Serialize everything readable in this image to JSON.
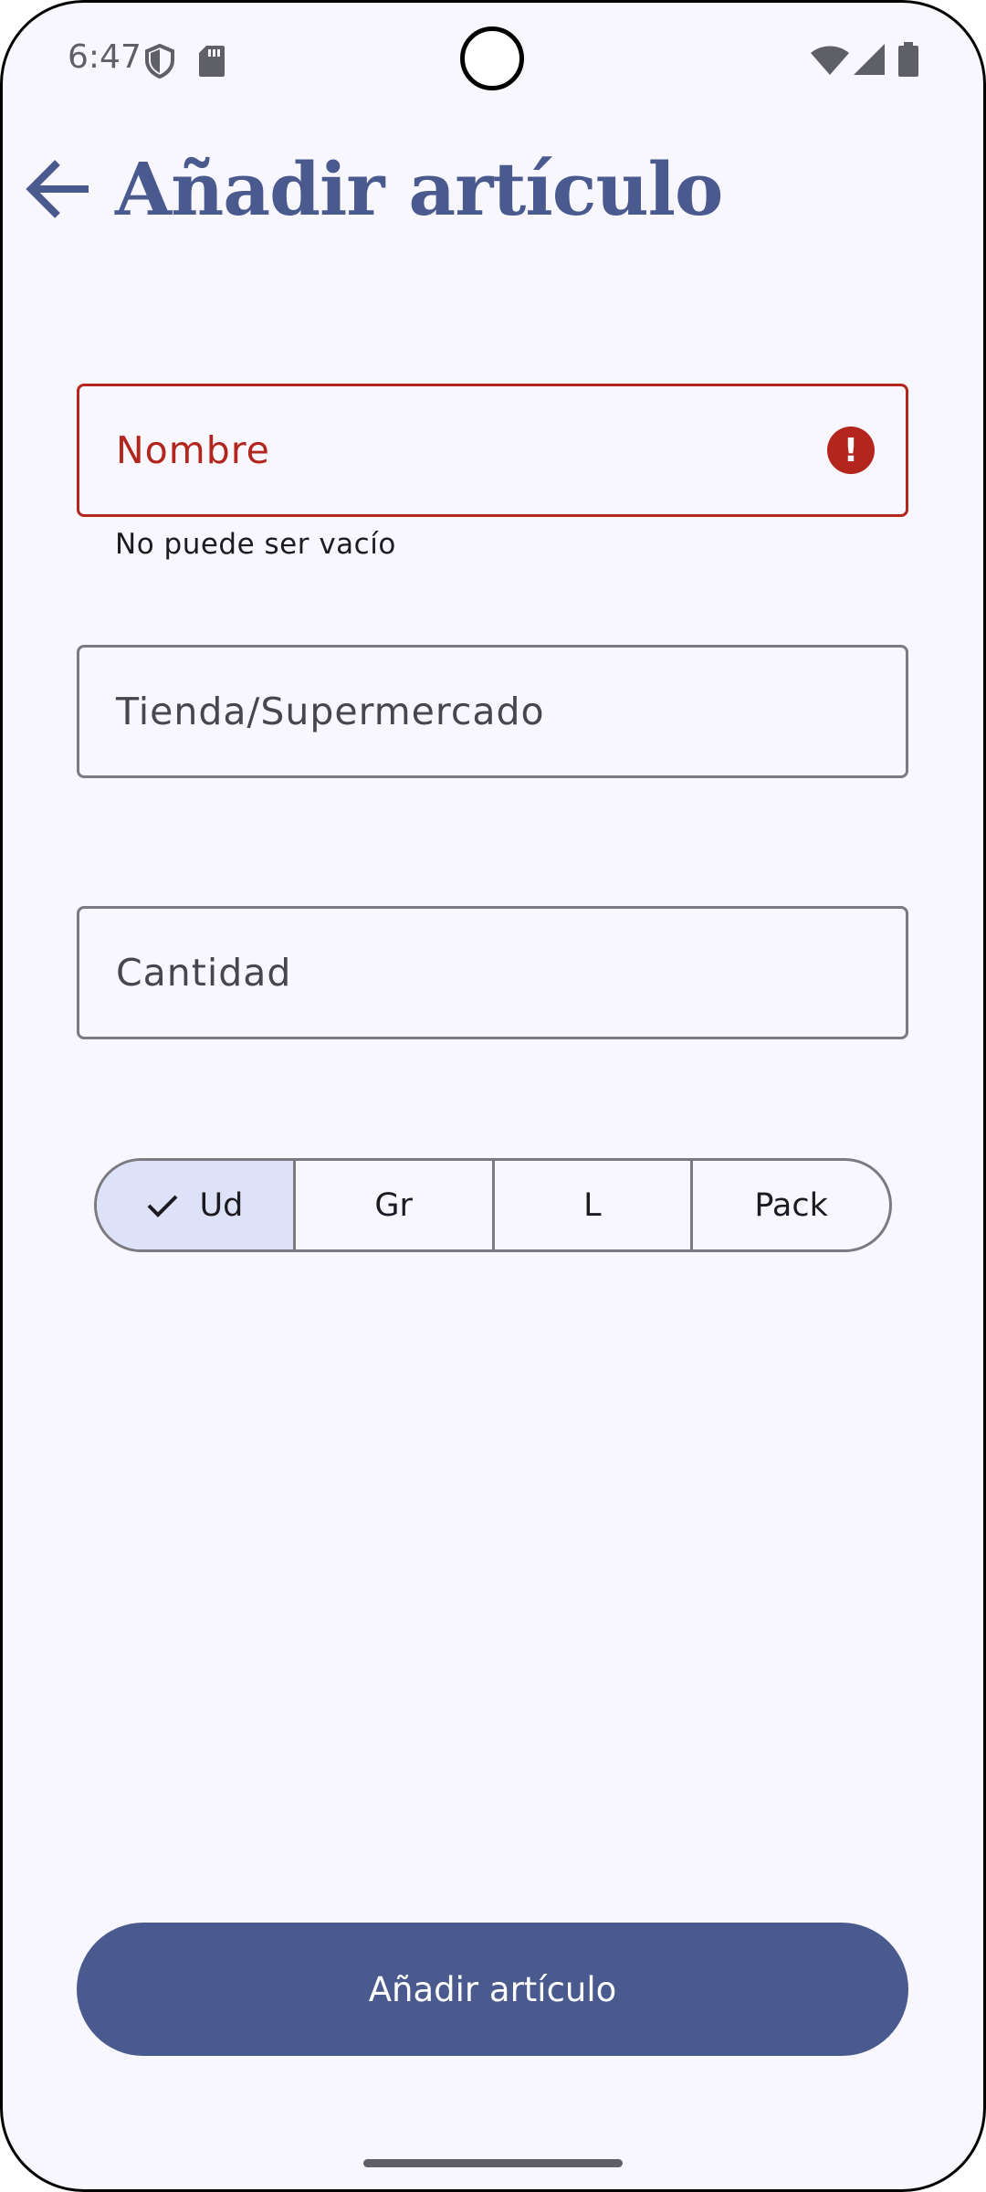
{
  "status_bar": {
    "time": "6:47",
    "icons": [
      "shield-icon",
      "sd-card-icon",
      "wifi-icon",
      "signal-icon",
      "battery-icon"
    ]
  },
  "header": {
    "back_icon": "arrow-back-icon",
    "title": "Añadir artículo"
  },
  "form": {
    "name_field": {
      "label": "Nombre",
      "value": "",
      "error": "No puede ser vacío",
      "error_icon": "error-icon",
      "error_icon_glyph": "!"
    },
    "store_field": {
      "label": "Tienda/Supermercado",
      "value": ""
    },
    "quantity_field": {
      "label": "Cantidad",
      "value": ""
    },
    "units": {
      "selected": "Ud",
      "options": [
        "Ud",
        "Gr",
        "L",
        "Pack"
      ]
    }
  },
  "submit_button": {
    "label": "Añadir artículo"
  },
  "colors": {
    "primary": "#4a5a8f",
    "error": "#b3261e",
    "background": "#f8f7fd",
    "selected_segment": "#dde2f8"
  }
}
